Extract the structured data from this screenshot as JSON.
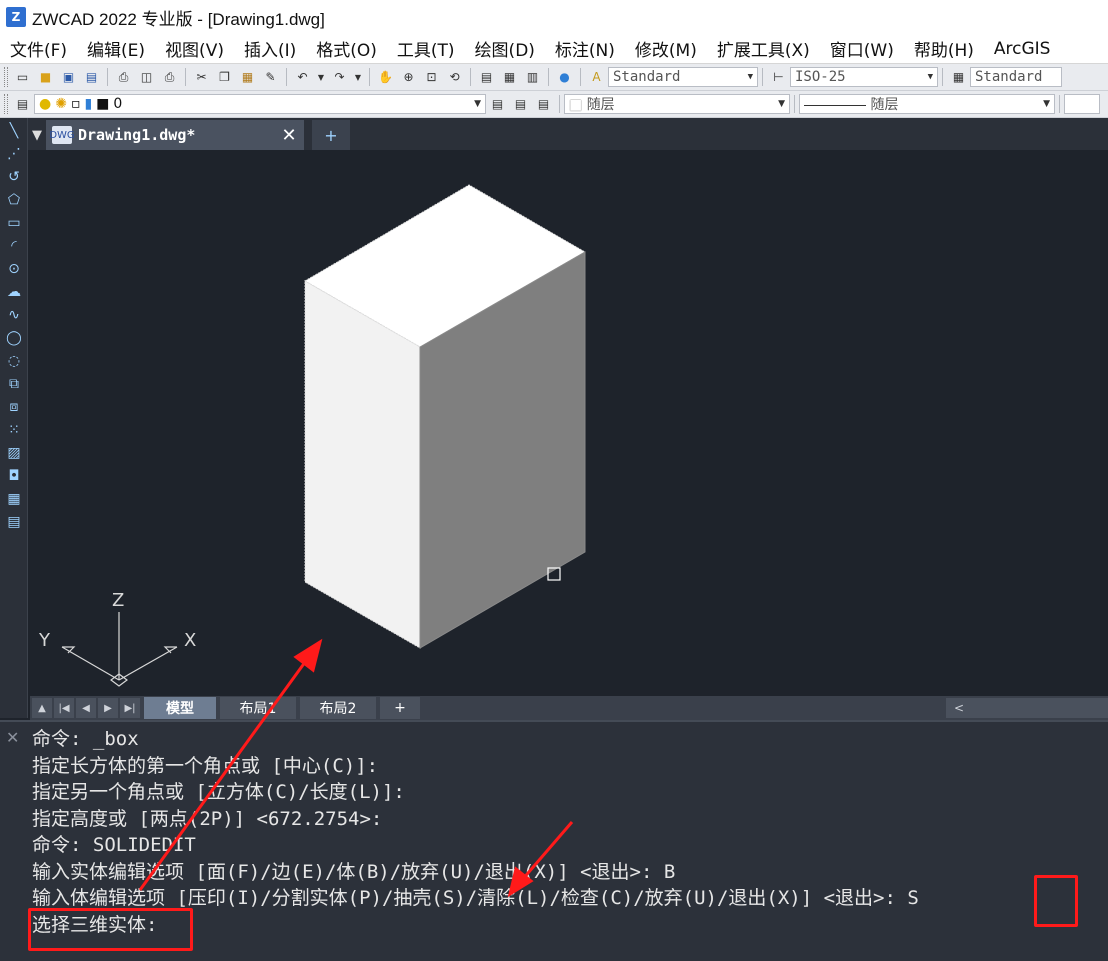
{
  "window": {
    "logo": "Z",
    "title": "ZWCAD 2022 专业版 - [Drawing1.dwg]"
  },
  "menu": [
    "文件(F)",
    "编辑(E)",
    "视图(V)",
    "插入(I)",
    "格式(O)",
    "工具(T)",
    "绘图(D)",
    "标注(N)",
    "修改(M)",
    "扩展工具(X)",
    "窗口(W)",
    "帮助(H)",
    "ArcGIS"
  ],
  "toolbar": {
    "text_style": "Standard",
    "dim_style": "ISO-25",
    "table_style": "Standard",
    "layer": "0",
    "color": "随层",
    "linetype": "随层"
  },
  "document_tab": {
    "label": "Drawing1.dwg*",
    "close": "✕",
    "new_tab": "+"
  },
  "ucs": {
    "x_label": "X",
    "y_label": "Y",
    "z_label": "Z"
  },
  "layout_tabs": {
    "model": "模型",
    "layout1": "布局1",
    "layout2": "布局2",
    "add": "+",
    "scroll_left": "<"
  },
  "command": {
    "close": "✕",
    "lines": [
      "命令: _box",
      "指定长方体的第一个角点或 [中心(C)]:",
      "指定另一个角点或 [立方体(C)/长度(L)]:",
      "指定高度或 [两点(2P)] <672.2754>:",
      "命令: SOLIDEDIT",
      "输入实体编辑选项 [面(F)/边(E)/体(B)/放弃(U)/退出(X)] <退出>: B",
      "输入体编辑选项 [压印(I)/分割实体(P)/抽壳(S)/清除(L)/检查(C)/放弃(U)/退出(X)] <退出>: S",
      "选择三维实体:"
    ]
  },
  "colors": {
    "annotation": "#ff1a1a",
    "viewport_bg": "#1e232b",
    "box_top": "#ffffff",
    "box_left": "#f2f2f2",
    "box_right": "#7f7f7f"
  }
}
